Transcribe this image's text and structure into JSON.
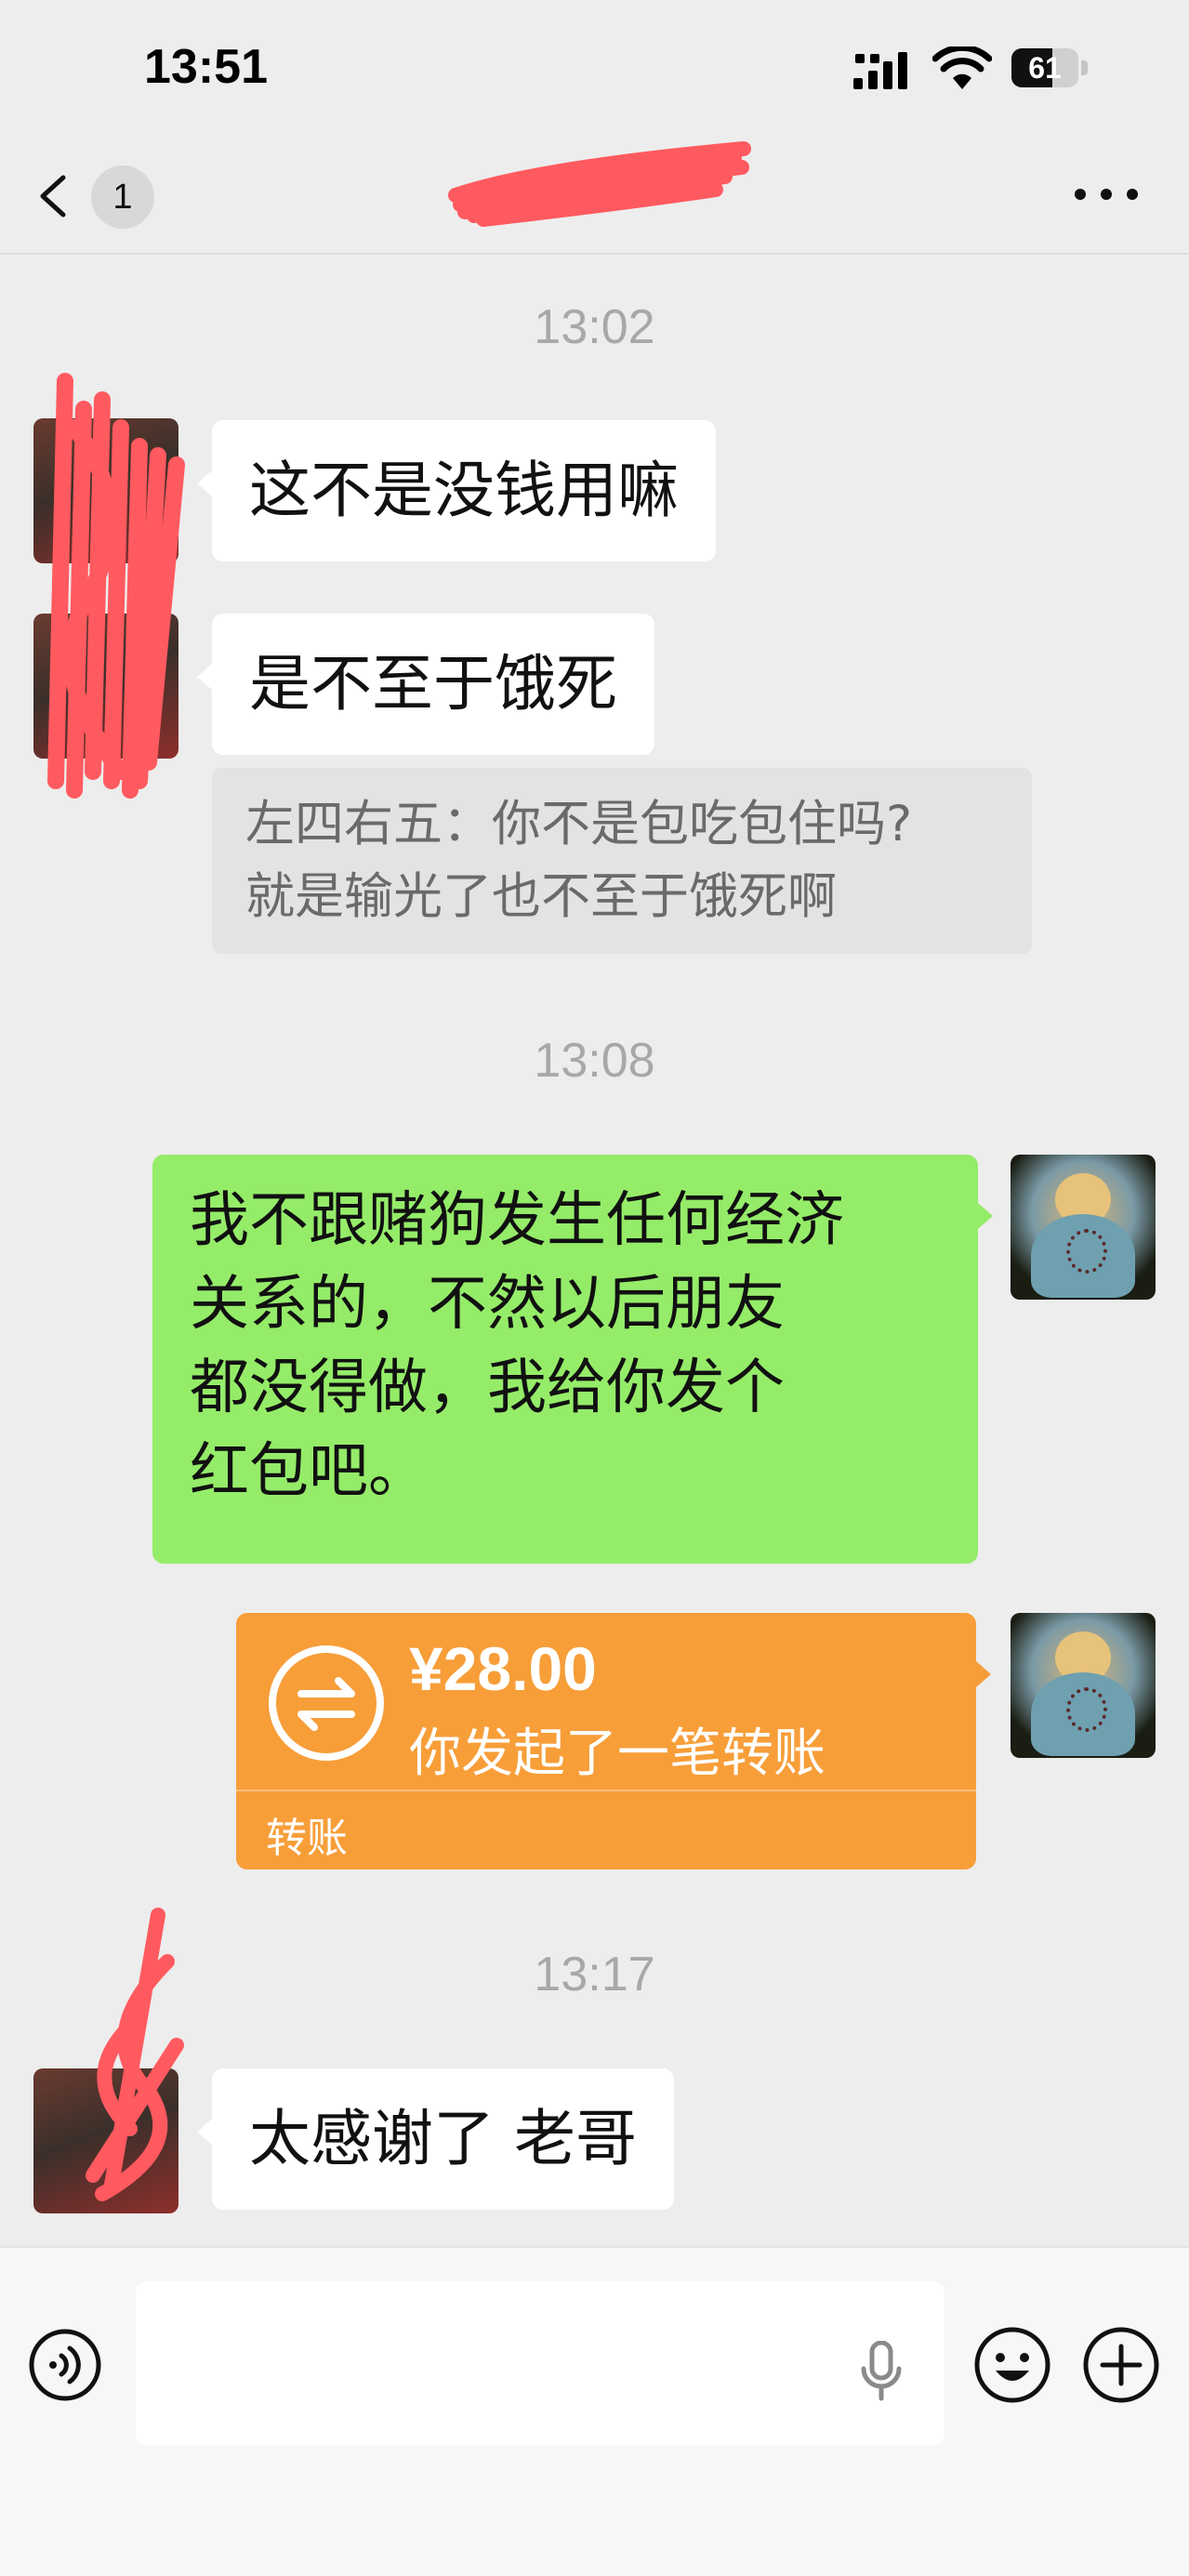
{
  "status_bar": {
    "time": "13:51",
    "battery": "61",
    "battery_level": 0.61
  },
  "nav": {
    "unread_count": "1",
    "title": "",
    "more_icon": "more-dots-icon"
  },
  "messages": {
    "ts1": "13:02",
    "m1": "这不是没钱用嘛",
    "m2": "是不至于饿死",
    "quote_line1": "左四右五：你不是包吃包住吗?",
    "quote_line2": "就是输光了也不至于饿死啊",
    "ts2": "13:08",
    "m3_line1": "我不跟赌狗发生任何经济",
    "m3_line2": "关系的，不然以后朋友",
    "m3_line3": "都没得做，我给你发个",
    "m3_line4": "红包吧。",
    "transfer": {
      "amount": "¥28.00",
      "description": "你发起了一笔转账",
      "label": "转账"
    },
    "ts3": "13:17",
    "m4": "太感谢了 老哥"
  },
  "input_bar": {
    "placeholder": ""
  },
  "colors": {
    "background": "#ededed",
    "bubble_self": "#95ec69",
    "bubble_other": "#ffffff",
    "transfer": "#f79e39",
    "redaction": "#ff5a5f"
  }
}
